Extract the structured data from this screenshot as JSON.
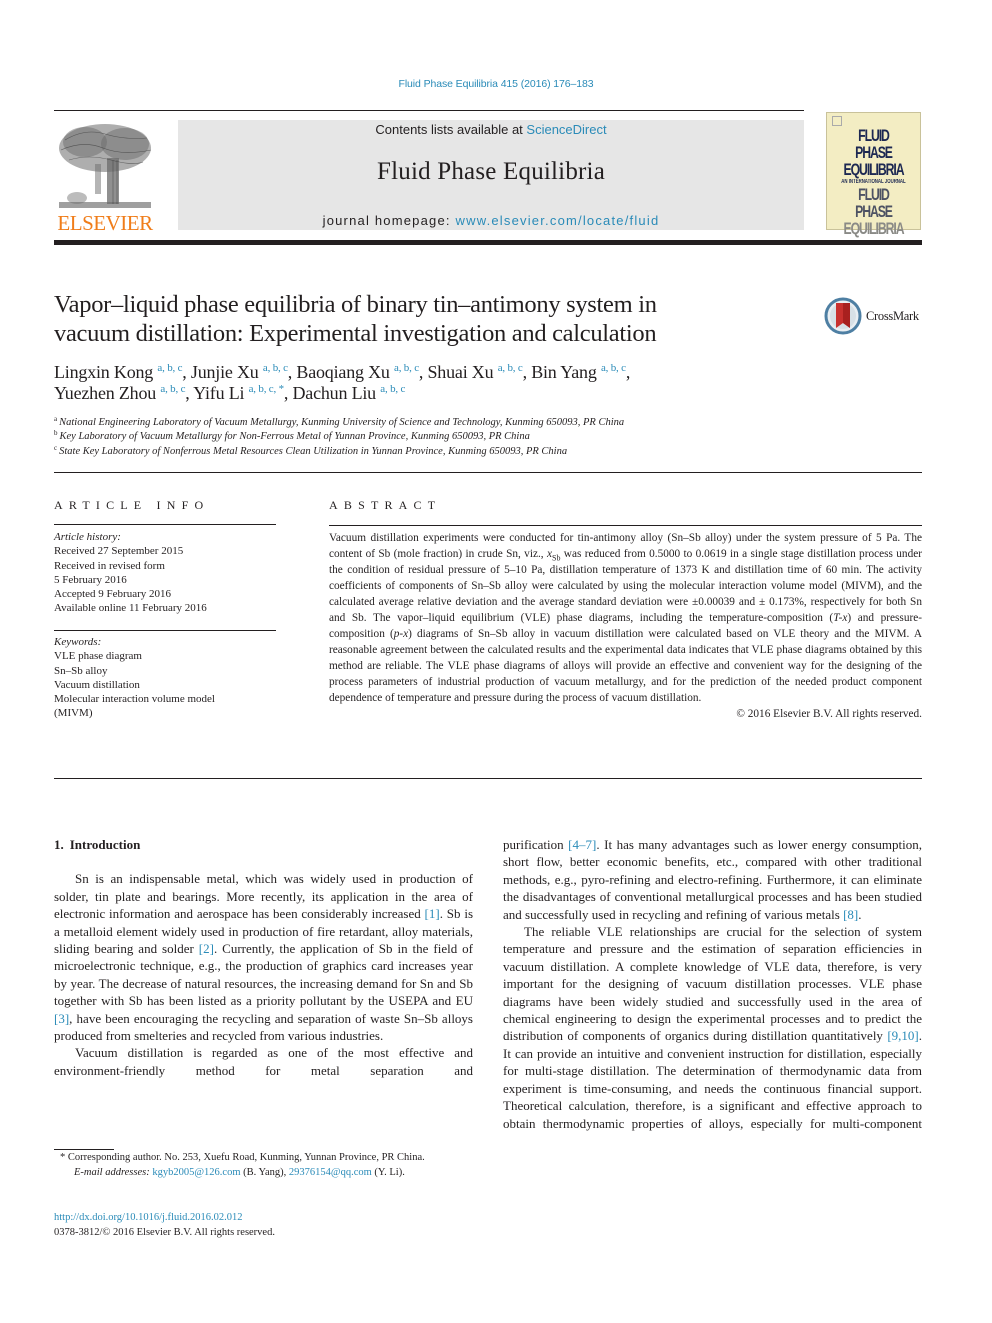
{
  "header": {
    "citation": "Fluid Phase Equilibria 415 (2016) 176–183",
    "contents_prefix": "Contents lists available at ",
    "contents_link": "ScienceDirect",
    "journal_name": "Fluid Phase Equilibria",
    "homepage_prefix": "journal homepage: ",
    "homepage_link": "www.elsevier.com/locate/fluid",
    "publisher_logo": "ELSEVIER",
    "cover_lines": [
      "FLUID PHASE",
      "EQUILIBRIA",
      "AN INTERNATIONAL JOURNAL",
      "FLUID PHASE",
      "EQUILIBRIA"
    ]
  },
  "article": {
    "title_line1": "Vapor–liquid phase equilibria of binary tin–antimony system in",
    "title_line2": "vacuum distillation: Experimental investigation and calculation",
    "crossmark_label": "CrossMark",
    "authors": [
      {
        "name": "Lingxin Kong",
        "affil": "a, b, c"
      },
      {
        "name": "Junjie Xu",
        "affil": "a, b, c"
      },
      {
        "name": "Baoqiang Xu",
        "affil": "a, b, c"
      },
      {
        "name": "Shuai Xu",
        "affil": "a, b, c"
      },
      {
        "name": "Bin Yang",
        "affil": "a, b, c"
      },
      {
        "name": "Yuezhen Zhou",
        "affil": "a, b, c"
      },
      {
        "name": "Yifu Li",
        "affil": "a, b, c, *"
      },
      {
        "name": "Dachun Liu",
        "affil": "a, b, c"
      }
    ],
    "affiliations": [
      {
        "mark": "a",
        "text": "National Engineering Laboratory of Vacuum Metallurgy, Kunming University of Science and Technology, Kunming 650093, PR China"
      },
      {
        "mark": "b",
        "text": "Key Laboratory of Vacuum Metallurgy for Non-Ferrous Metal of Yunnan Province, Kunming 650093, PR China"
      },
      {
        "mark": "c",
        "text": "State Key Laboratory of Nonferrous Metal Resources Clean Utilization in Yunnan Province, Kunming 650093, PR China"
      }
    ]
  },
  "article_info": {
    "heading": "ARTICLE INFO",
    "history_label": "Article history:",
    "history": [
      "Received 27 September 2015",
      "Received in revised form",
      "5 February 2016",
      "Accepted 9 February 2016",
      "Available online 11 February 2016"
    ],
    "keywords_label": "Keywords:",
    "keywords": [
      "VLE phase diagram",
      "Sn–Sb alloy",
      "Vacuum distillation",
      "Molecular interaction volume model",
      "(MIVM)"
    ]
  },
  "abstract": {
    "heading": "ABSTRACT",
    "part1": "Vacuum distillation experiments were conducted for tin-antimony alloy (Sn–Sb alloy) under the system pressure of 5 Pa. The content of Sb (mole fraction) in crude Sn, viz., ",
    "var_x": "x",
    "var_sub": "Sb",
    "part2": " was reduced from 0.5000 to 0.0619 in a single stage distillation process under the condition of residual pressure of 5–10 Pa, distillation temperature of 1373 K and distillation time of 60 min. The activity coefficients of components of Sn–Sb alloy were calculated by using the molecular interaction volume model (MIVM), and the calculated average relative deviation and the average standard deviation were ±0.00039 and ± 0.173%, respectively for both Sn and Sb. The vapor–liquid equilibrium (VLE) phase diagrams, including the temperature-composition (",
    "tx": "T-x",
    "part3": ") and pressure-composition (",
    "px": "p-x",
    "part4": ") diagrams of Sn–Sb alloy in vacuum distillation were calculated based on VLE theory and the MIVM. A reasonable agreement between the calculated results and the experimental data indicates that VLE phase diagrams obtained by this method are reliable. The VLE phase diagrams of alloys will provide an effective and convenient way for the designing of the process parameters of industrial production of vacuum metallurgy, and for the prediction of the needed product component dependence of temperature and pressure during the process of vacuum distillation.",
    "copyright": "© 2016 Elsevier B.V. All rights reserved."
  },
  "body": {
    "section_number": "1.",
    "section_title": "Introduction",
    "left_p1": [
      "Sn is an indispensable metal, which was widely used in production of solder, tin plate and bearings. More recently, its application in the area of electronic information and aerospace has been considerably increased ",
      "[1]",
      ". Sb is a metalloid element widely used in production of fire retardant, alloy materials, sliding bearing and solder ",
      "[2]",
      ". Currently, the application of Sb in the field of microelectronic technique, e.g., the production of graphics card increases year by year. The decrease of natural resources, the increasing demand for Sn and Sb together with Sb has been listed as a priority pollutant by the USEPA and EU ",
      "[3]",
      ", have been encouraging the recycling and separation of waste Sn–Sb alloys produced from smelteries and recycled from various industries."
    ],
    "left_p2": "Vacuum distillation is regarded as one of the most effective and environment-friendly method for metal separation and",
    "right_p1": [
      "purification ",
      "[4–7]",
      ". It has many advantages such as lower energy consumption, short flow, better economic benefits, etc., compared with other traditional methods, e.g., pyro-refining and electro-refining. Furthermore, it can eliminate the disadvantages of conventional metallurgical processes and has been studied and successfully used in recycling and refining of various metals ",
      "[8]",
      "."
    ],
    "right_p2": [
      "The reliable VLE relationships are crucial for the selection of system temperature and pressure and the estimation of separation efficiencies in vacuum distillation. A complete knowledge of VLE data, therefore, is very important for the designing of vacuum distillation processes. VLE phase diagrams have been widely studied and successfully used in the area of chemical engineering to design the experimental processes and to predict the distribution of components of organics during distillation quantitatively ",
      "[9,10]",
      ". It can provide an intuitive and convenient instruction for distillation, especially for multi-stage distillation. The determination of thermodynamic data from experiment is time-consuming, and needs the continuous financial support. Theoretical calculation, therefore, is a significant and effective approach to obtain thermodynamic properties of alloys, especially for multi-component"
    ]
  },
  "footnote": {
    "corresponding": "* Corresponding author. No. 253, Xuefu Road, Kunming, Yunnan Province, PR China.",
    "email_label": "E-mail addresses:",
    "email1": "kgyb2005@126.com",
    "email1_owner": " (B. Yang), ",
    "email2": "29376154@qq.com",
    "email2_owner": " (Y. Li)."
  },
  "doi": {
    "link": "http://dx.doi.org/10.1016/j.fluid.2016.02.012",
    "issn": "0378-3812/© 2016 Elsevier B.V. All rights reserved."
  },
  "colors": {
    "link": "#2a8bb8",
    "elsevier_orange": "#f07d1a",
    "masthead_bg": "#e6e6e6",
    "cover_bg": "#f3edc3"
  }
}
